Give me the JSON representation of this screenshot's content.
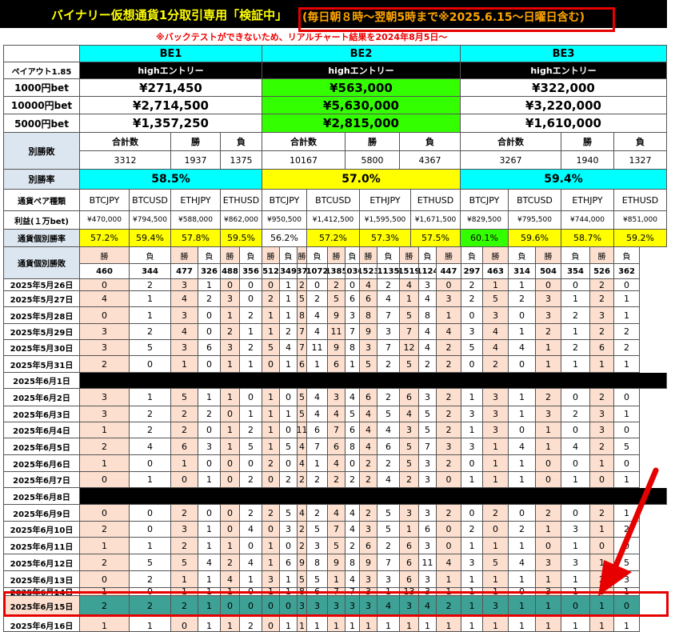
{
  "header": {
    "title": "バイナリー仮想通貨1分取引専用「検証中」",
    "highlight": "(毎日朝８時〜翌朝5時まで※2025.6.15〜日曜日含む)",
    "note": "※バックテストができないため、リアルチャート結果を2024年8月5日〜"
  },
  "colors": {
    "cyan": "#00ffff",
    "green": "#33ff00",
    "yellow": "#ffff00",
    "salmon": "#fcdfcf",
    "teal": "#3ea195",
    "grid": "#555555",
    "highlight_red": "#e60000"
  },
  "labels": {
    "payout": "ペイアウト1.85",
    "bet1000": "1000円bet",
    "bet10000": "10000円bet",
    "bet5000": "5000円bet",
    "winloss": "別勝敗",
    "winrate": "別勝率",
    "pair_type": "通貨ペア種類",
    "profit": "利益(１万bet)",
    "pair_rate": "通貨個別勝率",
    "pair_winloss": "通貨個別勝敗",
    "total": "合計数",
    "win": "勝",
    "loss": "負"
  },
  "groups": [
    {
      "name": "BE1",
      "entry": "highエントリー",
      "bet1000": "¥271,450",
      "bet10000": "¥2,714,500",
      "bet5000": "¥1,357,250",
      "total": "3312",
      "wins": "1937",
      "losses": "1375",
      "rate": "58.5%",
      "pairs": [
        {
          "name": "BTCJPY",
          "profit": "¥470,000",
          "rate": "57.2%",
          "w": "460",
          "l": "344"
        },
        {
          "name": "BTCUSD",
          "profit": "¥794,500",
          "rate": "59.4%",
          "w": "477",
          "l": "326"
        },
        {
          "name": "ETHJPY",
          "profit": "¥588,000",
          "rate": "57.8%",
          "w": "488",
          "l": "356"
        },
        {
          "name": "ETHUSD",
          "profit": "¥862,000",
          "rate": "59.5%",
          "w": "512",
          "l": "349"
        }
      ]
    },
    {
      "name": "BE2",
      "entry": "highエントリー",
      "bet1000": "¥563,000",
      "bet10000": "¥5,630,000",
      "bet5000": "¥2,815,000",
      "total": "10167",
      "wins": "5800",
      "losses": "4367",
      "rate": "57.0%",
      "pairs": [
        {
          "name": "BTCJPY",
          "profit": "¥950,500",
          "rate": "56.2%",
          "w": "1373",
          "l": "1072"
        },
        {
          "name": "BTCUSD",
          "profit": "¥1,412,500",
          "rate": "57.2%",
          "w": "1385",
          "l": "1036"
        },
        {
          "name": "ETHJPY",
          "profit": "¥1,595,500",
          "rate": "57.3%",
          "w": "1523",
          "l": "1135"
        },
        {
          "name": "ETHUSD",
          "profit": "¥1,671,500",
          "rate": "57.5%",
          "w": "1519",
          "l": "1124"
        }
      ]
    },
    {
      "name": "BE3",
      "entry": "highエントリー",
      "bet1000": "¥322,000",
      "bet10000": "¥3,220,000",
      "bet5000": "¥1,610,000",
      "total": "3267",
      "wins": "1940",
      "losses": "1327",
      "rate": "59.4%",
      "pairs": [
        {
          "name": "BTCJPY",
          "profit": "¥829,500",
          "rate": "60.1%",
          "w": "447",
          "l": "297"
        },
        {
          "name": "BTCUSD",
          "profit": "¥795,500",
          "rate": "59.6%",
          "w": "463",
          "l": "314"
        },
        {
          "name": "ETHJPY",
          "profit": "¥744,000",
          "rate": "58.7%",
          "w": "504",
          "l": "354"
        },
        {
          "name": "ETHUSD",
          "profit": "¥851,000",
          "rate": "59.2%",
          "w": "526",
          "l": "362"
        }
      ]
    }
  ],
  "rows": [
    {
      "date": "2025年5月26日",
      "type": "partial",
      "vals": [
        "0",
        "2",
        "3",
        "1",
        "0",
        "0",
        "0",
        "1",
        "2",
        "0",
        "2",
        "0",
        "4",
        "2",
        "4",
        "3",
        "0",
        "2",
        "1",
        "1",
        "0",
        "0",
        "2",
        "0"
      ]
    },
    {
      "date": "2025年5月27日",
      "vals": [
        "4",
        "1",
        "4",
        "2",
        "3",
        "0",
        "2",
        "1",
        "5",
        "2",
        "5",
        "6",
        "6",
        "4",
        "1",
        "4",
        "3",
        "2",
        "5",
        "2",
        "3",
        "1",
        "2",
        "1"
      ]
    },
    {
      "date": "2025年5月28日",
      "vals": [
        "0",
        "1",
        "3",
        "0",
        "1",
        "2",
        "1",
        "1",
        "8",
        "4",
        "9",
        "3",
        "8",
        "7",
        "5",
        "8",
        "1",
        "0",
        "3",
        "0",
        "3",
        "2",
        "3",
        "1"
      ]
    },
    {
      "date": "2025年5月29日",
      "vals": [
        "3",
        "2",
        "4",
        "0",
        "2",
        "1",
        "1",
        "2",
        "7",
        "4",
        "11",
        "7",
        "9",
        "3",
        "7",
        "4",
        "4",
        "3",
        "4",
        "1",
        "2",
        "1",
        "2",
        "2"
      ]
    },
    {
      "date": "2025年5月30日",
      "vals": [
        "3",
        "5",
        "3",
        "6",
        "3",
        "2",
        "5",
        "4",
        "7",
        "11",
        "9",
        "8",
        "3",
        "7",
        "12",
        "4",
        "2",
        "5",
        "4",
        "4",
        "1",
        "2",
        "6",
        "2"
      ]
    },
    {
      "date": "2025年5月31日",
      "vals": [
        "2",
        "0",
        "1",
        "0",
        "1",
        "1",
        "0",
        "1",
        "6",
        "1",
        "6",
        "1",
        "5",
        "2",
        "5",
        "2",
        "2",
        "0",
        "2",
        "0",
        "1",
        "1",
        "1",
        "1"
      ]
    },
    {
      "date": "2025年6月1日",
      "type": "black"
    },
    {
      "date": "2025年6月2日",
      "vals": [
        "3",
        "1",
        "5",
        "1",
        "1",
        "0",
        "1",
        "0",
        "5",
        "4",
        "3",
        "4",
        "6",
        "2",
        "6",
        "3",
        "2",
        "1",
        "3",
        "1",
        "2",
        "0",
        "2",
        "0"
      ]
    },
    {
      "date": "2025年6月3日",
      "vals": [
        "3",
        "2",
        "2",
        "2",
        "0",
        "1",
        "1",
        "1",
        "5",
        "4",
        "4",
        "5",
        "4",
        "5",
        "4",
        "5",
        "2",
        "3",
        "3",
        "1",
        "3",
        "2",
        "3",
        "1"
      ]
    },
    {
      "date": "2025年6月4日",
      "vals": [
        "1",
        "2",
        "2",
        "0",
        "1",
        "2",
        "1",
        "0",
        "11",
        "6",
        "7",
        "6",
        "4",
        "4",
        "3",
        "5",
        "2",
        "1",
        "3",
        "0",
        "1",
        "0",
        "3",
        "0"
      ]
    },
    {
      "date": "2025年6月5日",
      "vals": [
        "2",
        "4",
        "6",
        "3",
        "1",
        "5",
        "1",
        "5",
        "4",
        "7",
        "6",
        "8",
        "4",
        "6",
        "5",
        "7",
        "3",
        "3",
        "1",
        "4",
        "1",
        "4",
        "2",
        "5"
      ]
    },
    {
      "date": "2025年6月6日",
      "vals": [
        "1",
        "0",
        "1",
        "0",
        "0",
        "0",
        "2",
        "0",
        "4",
        "1",
        "4",
        "0",
        "2",
        "2",
        "5",
        "3",
        "2",
        "0",
        "1",
        "1",
        "0",
        "0",
        "1",
        "0"
      ]
    },
    {
      "date": "2025年6月7日",
      "vals": [
        "0",
        "1",
        "0",
        "1",
        "0",
        "2",
        "0",
        "2",
        "2",
        "2",
        "2",
        "2",
        "2",
        "4",
        "2",
        "3",
        "0",
        "1",
        "1",
        "1",
        "0",
        "1",
        "0",
        "1"
      ]
    },
    {
      "date": "2025年6月8日",
      "type": "black"
    },
    {
      "date": "2025年6月9日",
      "vals": [
        "0",
        "0",
        "2",
        "0",
        "0",
        "2",
        "2",
        "5",
        "4",
        "2",
        "4",
        "4",
        "2",
        "5",
        "3",
        "3",
        "2",
        "0",
        "2",
        "0",
        "2",
        "0",
        "2",
        "1"
      ]
    },
    {
      "date": "2025年6月10日",
      "vals": [
        "2",
        "0",
        "3",
        "1",
        "0",
        "4",
        "0",
        "3",
        "2",
        "5",
        "7",
        "4",
        "3",
        "5",
        "1",
        "6",
        "0",
        "2",
        "0",
        "2",
        "1",
        "3",
        "1",
        "2"
      ]
    },
    {
      "date": "2025年6月11日",
      "vals": [
        "1",
        "1",
        "2",
        "1",
        "1",
        "0",
        "1",
        "0",
        "2",
        "3",
        "5",
        "2",
        "6",
        "2",
        "6",
        "3",
        "0",
        "1",
        "1",
        "1",
        "0",
        "1",
        "0",
        "0"
      ]
    },
    {
      "date": "2025年6月12日",
      "vals": [
        "2",
        "5",
        "5",
        "4",
        "2",
        "4",
        "1",
        "6",
        "9",
        "8",
        "9",
        "8",
        "9",
        "7",
        "6",
        "11",
        "4",
        "3",
        "5",
        "4",
        "3",
        "3",
        "1",
        "5"
      ]
    },
    {
      "date": "2025年6月13日",
      "vals": [
        "0",
        "2",
        "1",
        "1",
        "4",
        "1",
        "3",
        "1",
        "5",
        "5",
        "1",
        "4",
        "3",
        "3",
        "6",
        "3",
        "1",
        "1",
        "1",
        "1",
        "1",
        "1",
        "2",
        "3"
      ]
    },
    {
      "date": "2025年6月14日",
      "vals": [
        "1",
        "0",
        "1",
        "1",
        "1",
        "0",
        "1",
        "1",
        "8",
        "6",
        "7",
        "7",
        "3",
        "1",
        "13",
        "3",
        "1",
        "1",
        "1",
        "0",
        "3",
        "1",
        "3",
        "1"
      ]
    },
    {
      "date": "2025年6月15日",
      "type": "teal",
      "vals": [
        "2",
        "2",
        "2",
        "1",
        "0",
        "0",
        "0",
        "0",
        "3",
        "3",
        "3",
        "3",
        "3",
        "4",
        "3",
        "4",
        "2",
        "1",
        "3",
        "1",
        "1",
        "0",
        "1",
        "0"
      ]
    },
    {
      "date": "2025年6月16日",
      "type": "partial",
      "vals": [
        "1",
        "1",
        "0",
        "1",
        "1",
        "2",
        "0",
        "1",
        "1",
        "1",
        "1",
        "1",
        "1",
        "1",
        "1",
        "1",
        "1",
        "1",
        "1",
        "1",
        "1",
        "1",
        "1",
        "1"
      ]
    }
  ]
}
